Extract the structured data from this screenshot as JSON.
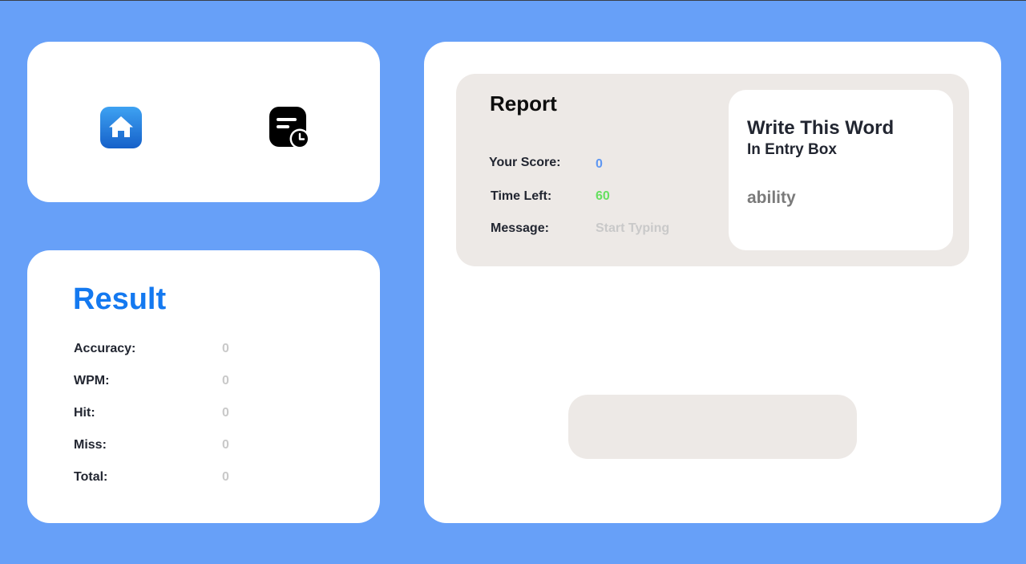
{
  "nav": {
    "home_icon": "home-icon",
    "history_icon": "history-clock-icon"
  },
  "result": {
    "title": "Result",
    "rows": [
      {
        "label": "Accuracy:",
        "value": "0"
      },
      {
        "label": "WPM:",
        "value": "0"
      },
      {
        "label": "Hit:",
        "value": "0"
      },
      {
        "label": "Miss:",
        "value": "0"
      },
      {
        "label": "Total:",
        "value": "0"
      }
    ]
  },
  "report": {
    "title": "Report",
    "score_label": "Your Score:",
    "score_value": "0",
    "time_label": "Time Left:",
    "time_value": "60",
    "message_label": "Message:",
    "message_value": "Start Typing"
  },
  "word_prompt": {
    "title": "Write This Word",
    "subtitle": "In Entry Box",
    "word": "ability"
  },
  "entry": {
    "value": ""
  },
  "colors": {
    "background": "#67a0f8",
    "accent": "#1479f0",
    "score": "#5f97f2",
    "time": "#66e060",
    "muted": "#c9c9c9",
    "panel": "#ede9e6"
  }
}
